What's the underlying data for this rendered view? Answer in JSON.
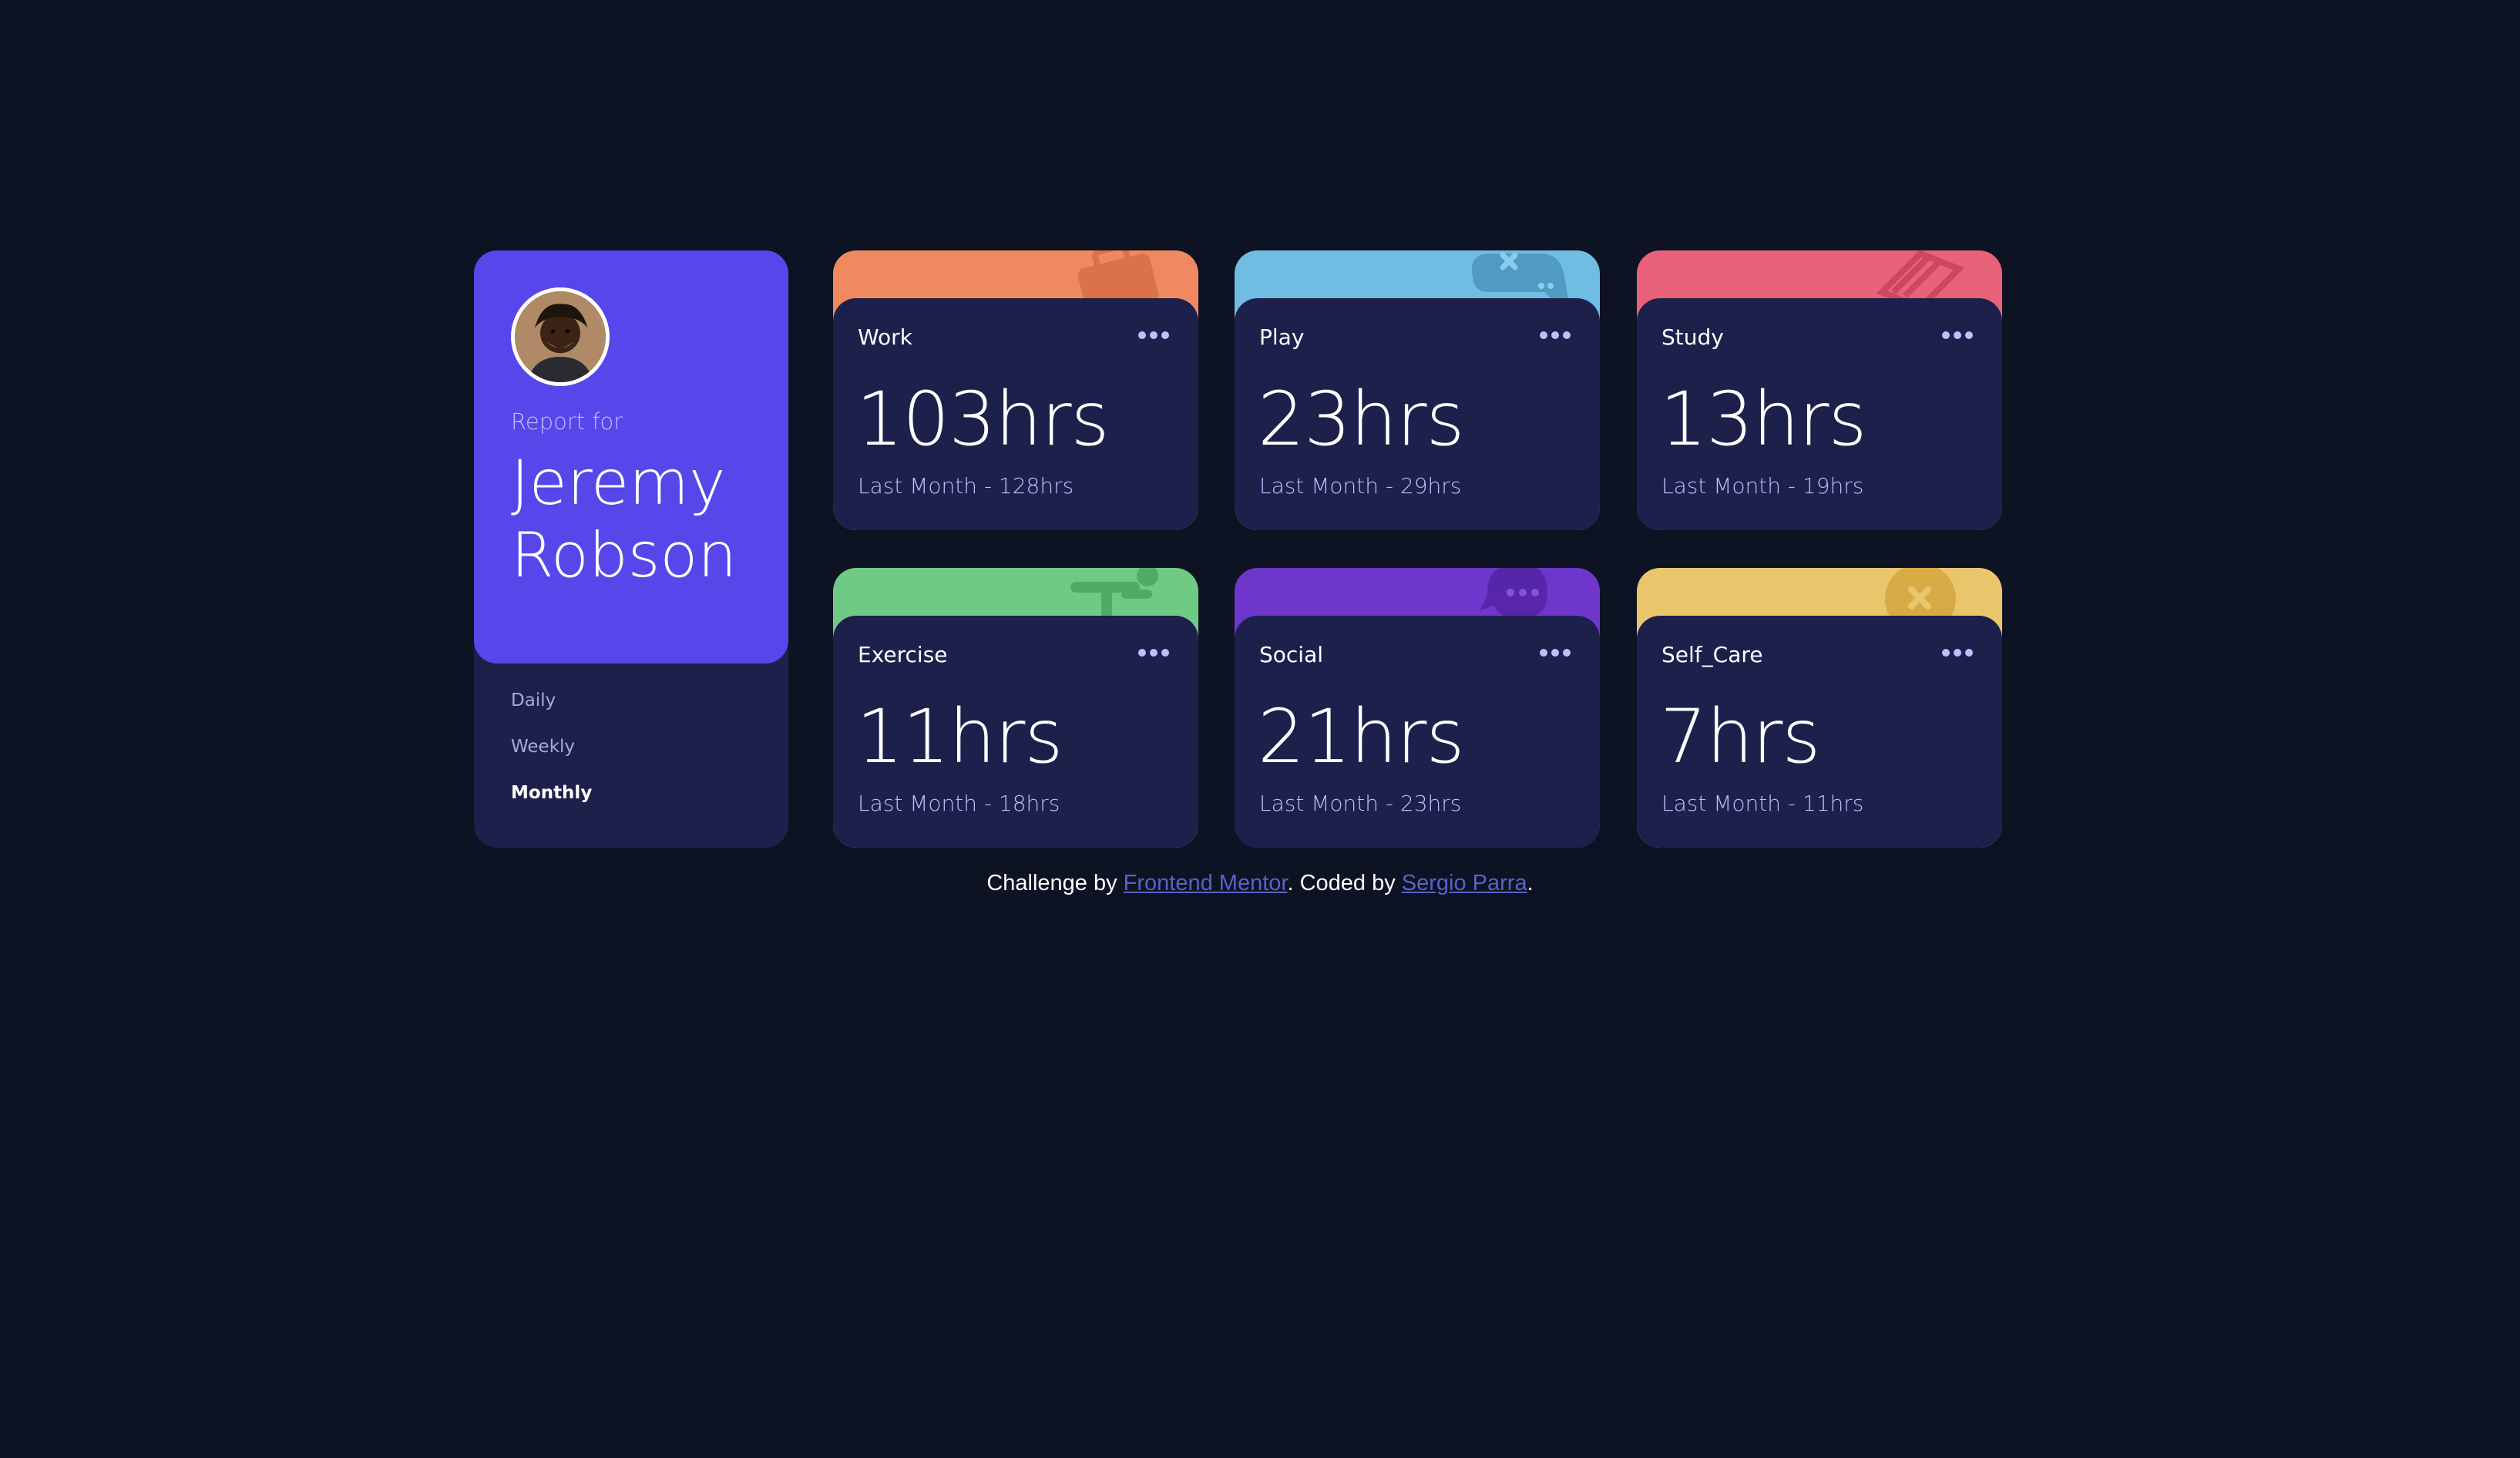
{
  "profile": {
    "report_label": "Report for",
    "name": "Jeremy Robson",
    "avatar_icon": "avatar-photo"
  },
  "timeframes": [
    {
      "label": "Daily",
      "active": false
    },
    {
      "label": "Weekly",
      "active": false
    },
    {
      "label": "Monthly",
      "active": true
    }
  ],
  "cards": [
    {
      "title": "Work",
      "current": "103hrs",
      "previous": "Last Month - 128hrs",
      "color": "#ff8b64",
      "icon": "briefcase-icon"
    },
    {
      "title": "Play",
      "current": "23hrs",
      "previous": "Last Month - 29hrs",
      "color": "#55c2e6",
      "icon": "gamepad-icon"
    },
    {
      "title": "Study",
      "current": "13hrs",
      "previous": "Last Month - 19hrs",
      "color": "#ff5e7d",
      "icon": "books-icon"
    },
    {
      "title": "Exercise",
      "current": "11hrs",
      "previous": "Last Month - 18hrs",
      "color": "#4bcf82",
      "icon": "runner-icon"
    },
    {
      "title": "Social",
      "current": "21hrs",
      "previous": "Last Month - 23hrs",
      "color": "#7335d2",
      "icon": "chat-bubble-icon"
    },
    {
      "title": "Self_Care",
      "current": "7hrs",
      "previous": "Last Month - 11hrs",
      "color": "#f1c75b",
      "icon": "heart-icon"
    }
  ],
  "footer": {
    "challenge_by": "Challenge by ",
    "frontend_mentor": "Frontend Mentor",
    "coded_by": ". Coded by ",
    "author": "Sergio Parra",
    "end": "."
  },
  "colors": {
    "background": "#0d1323",
    "card": "#1c204b",
    "profile_accent": "#5747ea",
    "muted_text": "#bbc0ff"
  }
}
